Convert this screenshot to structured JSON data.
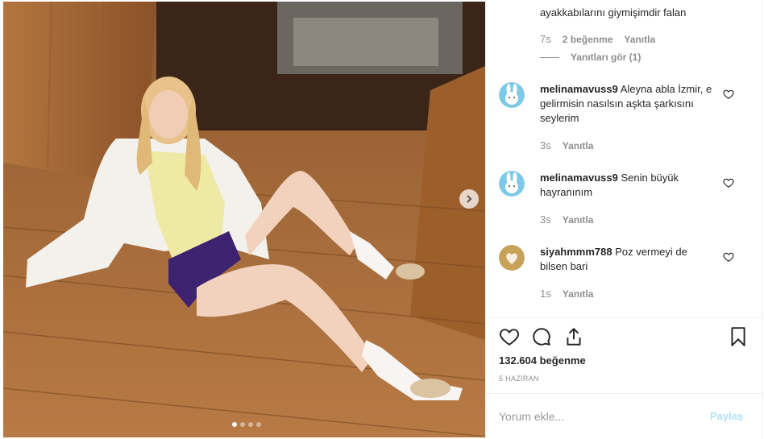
{
  "post": {
    "photo_dots": 4,
    "active_dot": 0,
    "icons": {
      "next": "chevron-right-icon"
    }
  },
  "comments_panel": {
    "cut_off_text": "ayakkabılarını giymişimdir falan",
    "previous_comment_meta": {
      "time": "7s",
      "likes": "2 beğenme",
      "reply": "Yanıtla"
    },
    "view_replies": "Yanıtları gör (1)",
    "comments": [
      {
        "username": "melinamavuss9",
        "text": "Aleyna abla İzmir, e gelirmisin nasılsın aşkta şarkısını seylerim",
        "time": "3s",
        "reply": "Yanıtla",
        "avatar_icon": "bunny-avatar-icon"
      },
      {
        "username": "melinamavuss9",
        "text": "Senin büyük hayranınım",
        "time": "3s",
        "reply": "Yanıtla",
        "avatar_icon": "bunny-avatar-icon"
      },
      {
        "username": "siyahmmm788",
        "text": "Poz vermeyi de bilsen bari",
        "time": "1s",
        "reply": "Yanıtla",
        "avatar_icon": "heart-hands-avatar-icon"
      }
    ]
  },
  "actions": {
    "icons": [
      "heart-icon",
      "comment-icon",
      "share-icon",
      "bookmark-icon"
    ],
    "likes": "132.604 beğenme",
    "date": "5 HAZİRAN"
  },
  "comment_box": {
    "placeholder": "Yorum ekle...",
    "share_label": "Paylaş"
  },
  "colors": {
    "link_blue_disabled": "#b2dffc",
    "muted": "#8e8e8e",
    "text": "#262626",
    "border": "#efefef"
  }
}
